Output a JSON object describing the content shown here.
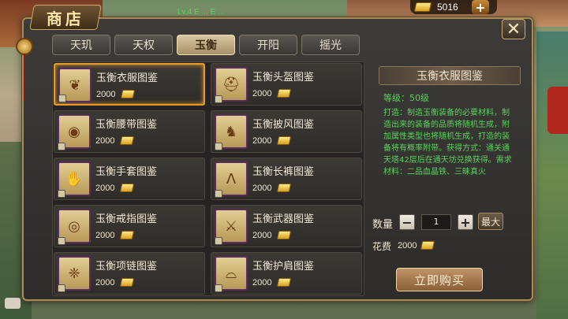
{
  "top_message": "Lv.4 E ... E ...",
  "currency": {
    "gold": "5016",
    "plus_label": "+"
  },
  "shop": {
    "title": "商店",
    "close_label": "✕",
    "tabs": [
      {
        "label": "天玑",
        "active": false
      },
      {
        "label": "天权",
        "active": false
      },
      {
        "label": "玉衡",
        "active": true
      },
      {
        "label": "开阳",
        "active": false
      },
      {
        "label": "摇光",
        "active": false
      }
    ],
    "items": [
      {
        "name": "玉衡衣服图鉴",
        "price": "2000",
        "icon": "robe-icon",
        "glyph": "❦"
      },
      {
        "name": "玉衡头盔图鉴",
        "price": "2000",
        "icon": "helmet-icon",
        "glyph": "⛑"
      },
      {
        "name": "玉衡腰带图鉴",
        "price": "2000",
        "icon": "belt-icon",
        "glyph": "◉"
      },
      {
        "name": "玉衡披风图鉴",
        "price": "2000",
        "icon": "cape-icon",
        "glyph": "♞"
      },
      {
        "name": "玉衡手套图鉴",
        "price": "2000",
        "icon": "glove-icon",
        "glyph": "✋"
      },
      {
        "name": "玉衡长裤图鉴",
        "price": "2000",
        "icon": "pants-icon",
        "glyph": "Ʌ"
      },
      {
        "name": "玉衡戒指图鉴",
        "price": "2000",
        "icon": "ring-icon",
        "glyph": "◎"
      },
      {
        "name": "玉衡武器图鉴",
        "price": "2000",
        "icon": "weapon-icon",
        "glyph": "⚔"
      },
      {
        "name": "玉衡项链图鉴",
        "price": "2000",
        "icon": "necklace-icon",
        "glyph": "❈"
      },
      {
        "name": "玉衡护肩图鉴",
        "price": "2000",
        "icon": "shoulder-icon",
        "glyph": "⌓"
      }
    ],
    "selected_index": 0
  },
  "detail": {
    "title": "玉衡衣服图鉴",
    "level": "等级：50级",
    "description": "打造：制造玉衡装备的必要材料，制造出来的装备的品质将随机生成，附加属性类型也将随机生成，打造的装备将有概率附带。获得方式：通关通天塔42层后在通天坊兑换获得。需求材料：二品血晶铁、三昧真火",
    "quantity_label": "数量",
    "minus_label": "−",
    "quantity_value": "1",
    "plus_label": "+",
    "max_label": "最大",
    "cost_label": "花费",
    "cost_value": "2000",
    "buy_label": "立即购买"
  }
}
